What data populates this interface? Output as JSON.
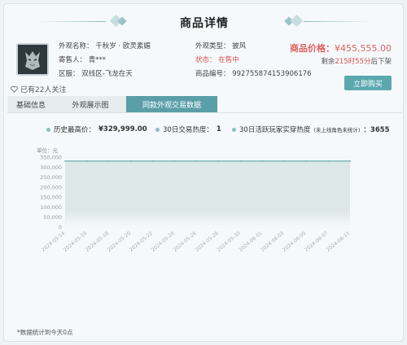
{
  "header": {
    "title": "商品详情"
  },
  "item": {
    "name_label": "外观名称：",
    "name": "千秋岁 · 欧灵素媚",
    "seller_label": "寄售人：",
    "seller": "青***",
    "server_label": "区服：",
    "server": "双线区-飞龙在天",
    "type_label": "外观类型：",
    "type": "披风",
    "status_label": "状态：",
    "status": "在售中",
    "code_label": "商品编号：",
    "code": "99275587415390617​6",
    "price_label": "商品价格：",
    "price": "¥455,555.00",
    "countdown_prefix": "剩余",
    "countdown": "215时55分",
    "countdown_suffix": "后下架",
    "buy_label": "立即购买",
    "follow": "已有22人关注"
  },
  "tabs": [
    {
      "label": "基础信息",
      "active": false
    },
    {
      "label": "外观展示图",
      "active": false
    },
    {
      "label": "同款外观交易数据",
      "active": true
    }
  ],
  "stats": {
    "high_label": "历史最高价：",
    "high_value": "¥329,999.00",
    "heat_label": "30日交易热度：",
    "heat_value": "1",
    "players_label": "30日活跃玩家实穿热度",
    "players_note": "(未上线角色未统计)",
    "players_value": "：3655"
  },
  "chart_data": {
    "type": "area",
    "y_unit": "单位：元",
    "ylim": [
      0,
      350000
    ],
    "y_ticks": [
      "350,000",
      "300,000",
      "250,000",
      "200,000",
      "150,000",
      "100,000",
      "50,000",
      "0"
    ],
    "x": [
      "2024-05-14",
      "2024-05-16",
      "2024-05-18",
      "2024-05-20",
      "2024-05-22",
      "2024-05-24",
      "2024-05-26",
      "2024-05-28",
      "2024-05-30",
      "2024-06-01",
      "2024-06-03",
      "2024-06-05",
      "2024-06-07",
      "2024-06-11"
    ],
    "values": [
      329999,
      329999,
      329999,
      329999,
      329999,
      329999,
      329999,
      329999,
      329999,
      329999,
      329999,
      329999,
      329999,
      329999
    ],
    "line_color": "#5aa3ab",
    "fill_color": "#dde7e8"
  },
  "footnote": "*数据统计到今天0点"
}
